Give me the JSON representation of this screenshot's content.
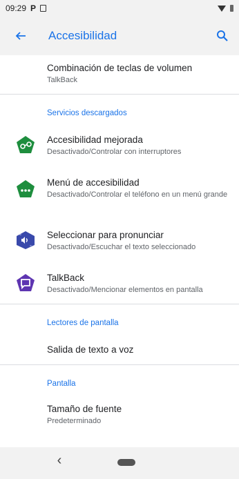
{
  "status_bar": {
    "time": "09:29",
    "notification_letter": "P"
  },
  "app_bar": {
    "title": "Accesibilidad",
    "back_icon": "arrow-left-icon",
    "search_icon": "search-icon"
  },
  "rows": [
    {
      "title": "Combinación de teclas de volumen",
      "subtitle": "TalkBack"
    }
  ],
  "sections": {
    "downloaded": "Servicios descargados",
    "readers": "Lectores de pantalla",
    "display": "Pantalla"
  },
  "services": [
    {
      "title": "Accesibilidad mejorada",
      "subtitle": "Desactivado/Controlar con interruptores",
      "icon": "switch-access-icon",
      "color": "#1e8e3e"
    },
    {
      "title": "Menú de accesibilidad",
      "subtitle": "Desactivado/Controlar el teléfono en un menú grande",
      "icon": "accessibility-menu-icon",
      "color": "#1e8e3e"
    },
    {
      "title": "Seleccionar para pronunciar",
      "subtitle": "Desactivado/Escuchar el texto seleccionado",
      "icon": "select-to-speak-icon",
      "color": "#3949ab"
    },
    {
      "title": "TalkBack",
      "subtitle": "Desactivado/Mencionar elementos en pantalla",
      "icon": "talkback-icon",
      "color": "#5e35b1"
    }
  ],
  "readers": [
    {
      "title": "Salida de texto a voz"
    }
  ],
  "display": [
    {
      "title": "Tamaño de fuente",
      "subtitle": "Predeterminado"
    }
  ],
  "nav_bar": {
    "back_glyph": "‹"
  }
}
